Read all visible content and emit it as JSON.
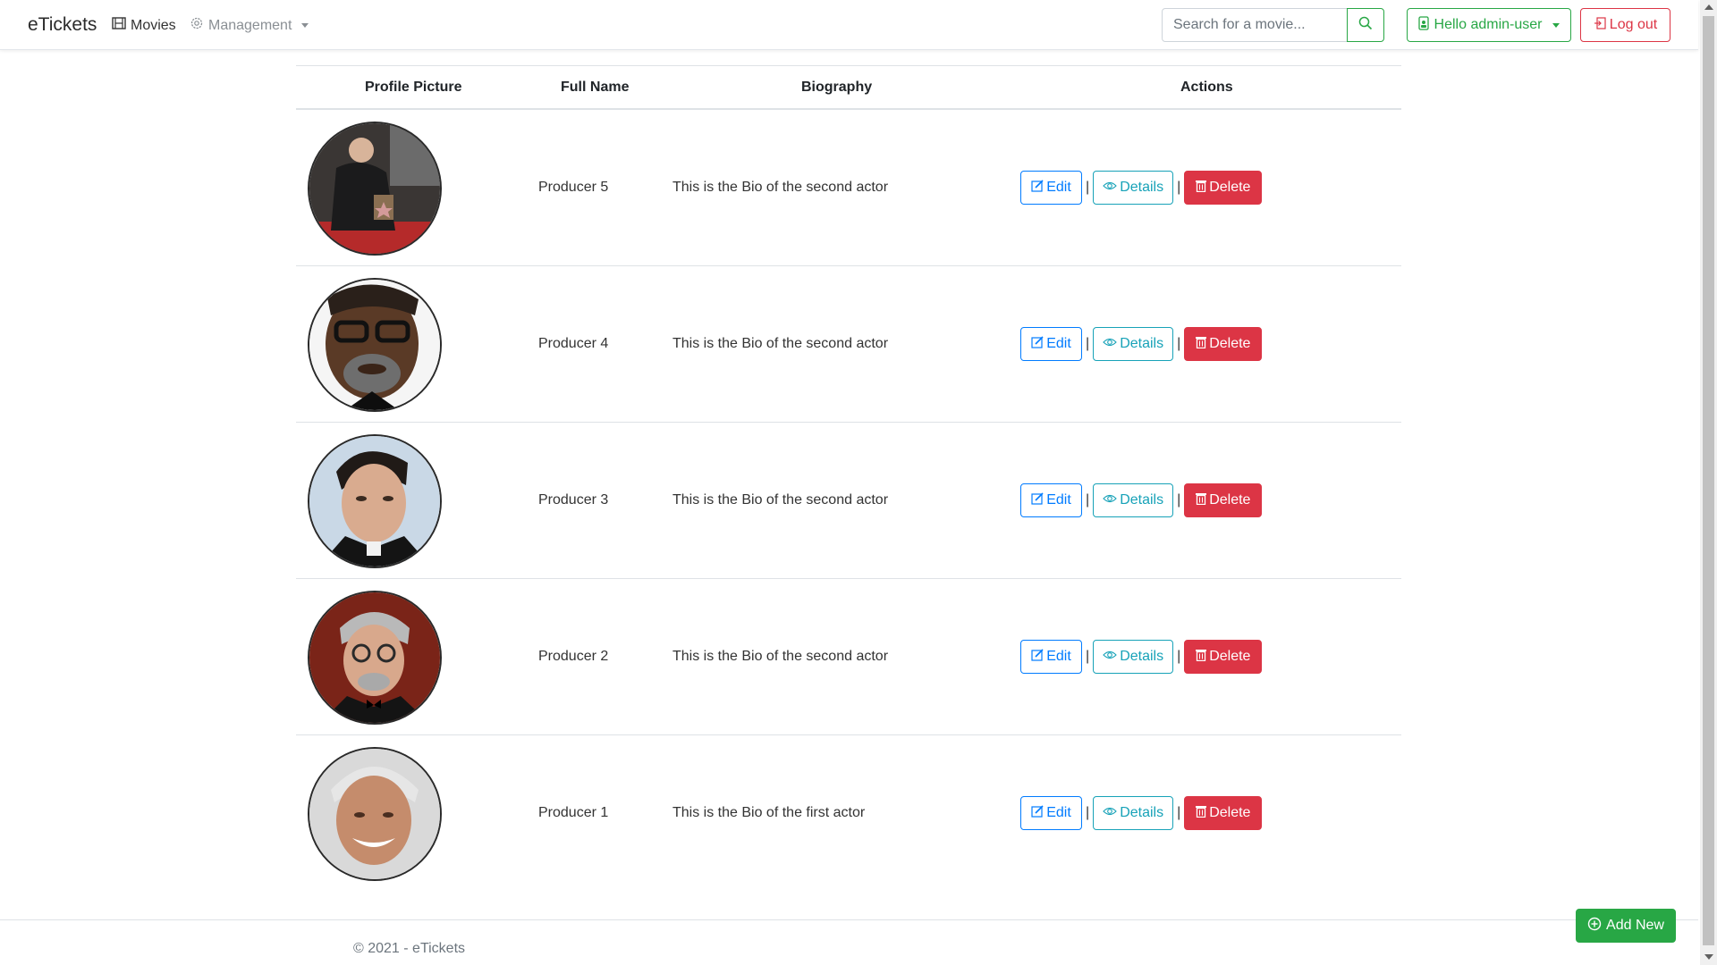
{
  "navbar": {
    "brand": "eTickets",
    "movies_label": "Movies",
    "management_label": "Management",
    "search_placeholder": "Search for a movie...",
    "user_label": "Hello admin-user",
    "logout_label": "Log out"
  },
  "table": {
    "headers": [
      "Profile Picture",
      "Full Name",
      "Biography",
      "Actions"
    ],
    "rows": [
      {
        "name": "Producer 5",
        "bio": "This is the Bio of the second actor"
      },
      {
        "name": "Producer 4",
        "bio": "This is the Bio of the second actor"
      },
      {
        "name": "Producer 3",
        "bio": "This is the Bio of the second actor"
      },
      {
        "name": "Producer 2",
        "bio": "This is the Bio of the second actor"
      },
      {
        "name": "Producer 1",
        "bio": "This is the Bio of the first actor"
      }
    ],
    "action_labels": {
      "edit": "Edit",
      "details": "Details",
      "delete": "Delete",
      "separator": "|"
    }
  },
  "footer": {
    "copyright": "© 2021 - eTickets",
    "add_new_label": "Add New"
  },
  "icons": {
    "movies": "film-icon",
    "management": "gear-icon",
    "search": "search-icon",
    "user": "user-badge-icon",
    "logout": "logout-icon",
    "edit": "edit-icon",
    "details": "eye-icon",
    "delete": "trash-icon",
    "add": "plus-circle-icon"
  },
  "colors": {
    "success": "#28a745",
    "danger": "#dc3545",
    "primary": "#007bff",
    "info": "#17a2b8"
  }
}
